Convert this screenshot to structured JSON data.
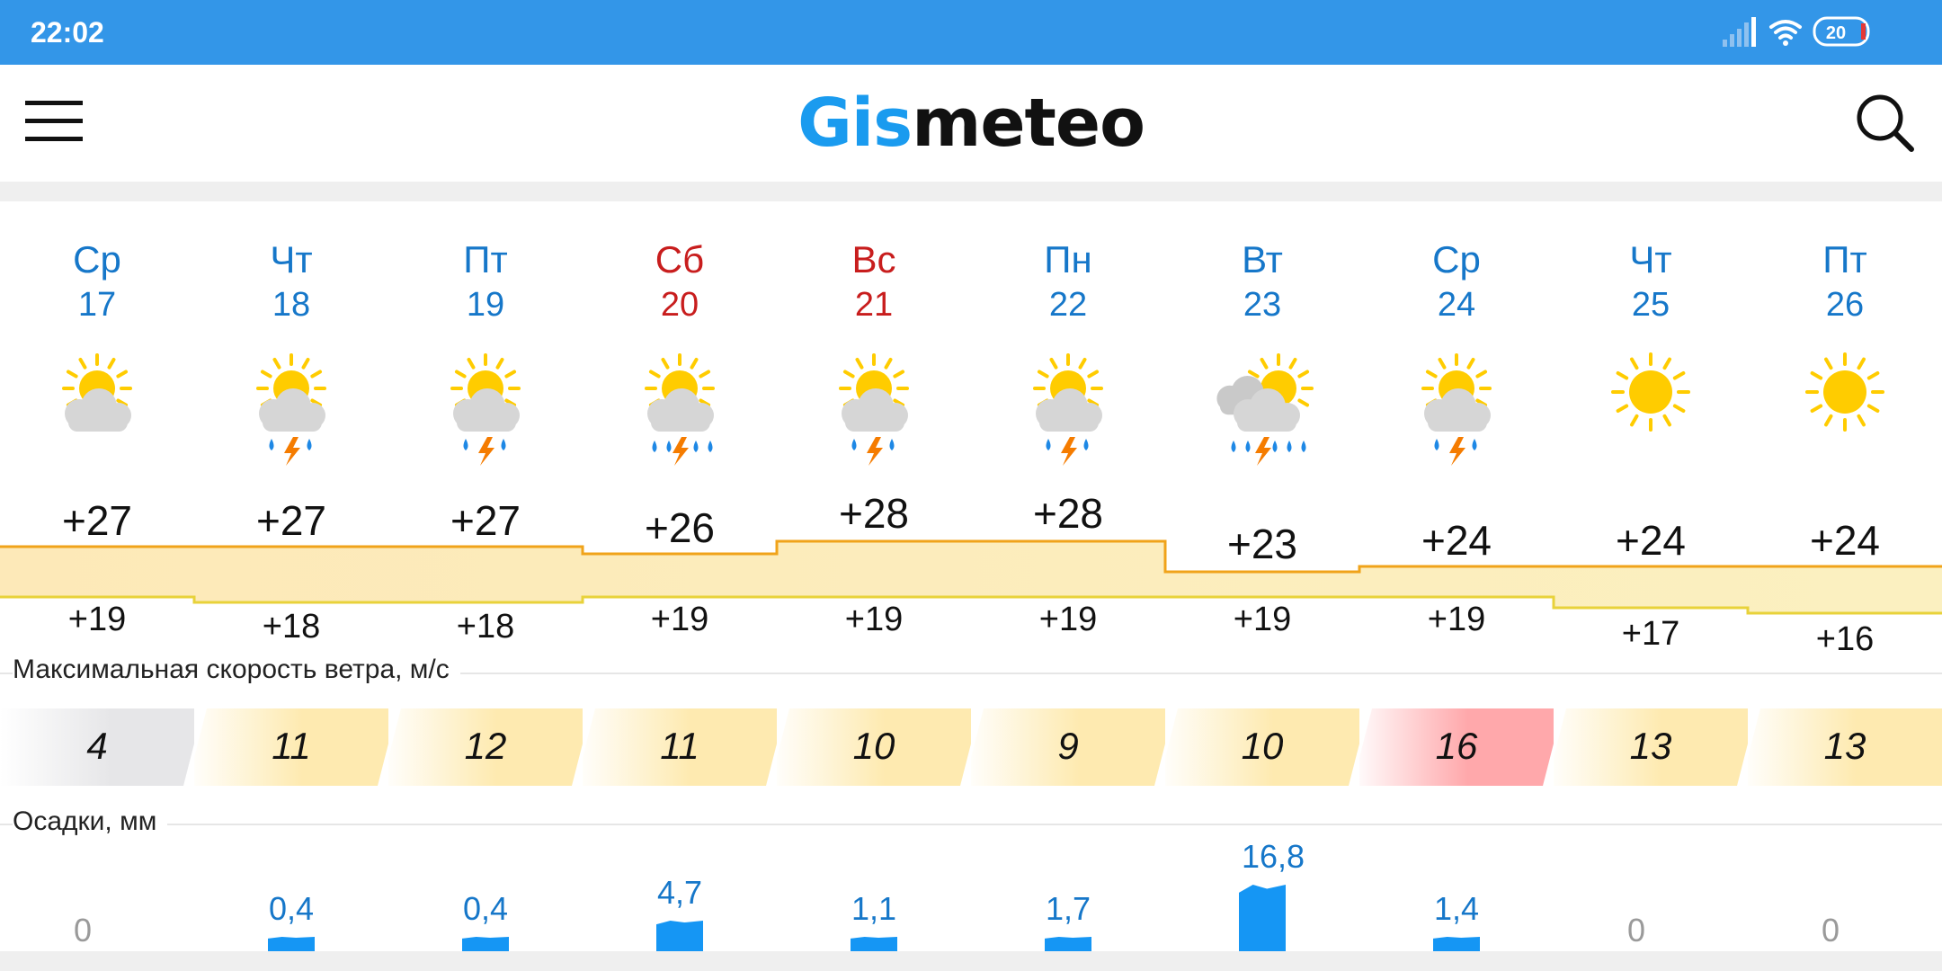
{
  "status": {
    "time": "22:02",
    "battery": "20"
  },
  "app": {
    "logo_part1": "Gis",
    "logo_part2": "meteo"
  },
  "colors": {
    "accent": "#3396e8",
    "logo_blue": "#1a9bef",
    "weekday": "#1677c9",
    "weekend": "#c81d1d",
    "precip": "#1596f4"
  },
  "days": [
    {
      "name": "Ср",
      "date": "17",
      "weekend": false,
      "icon": "sun-cloud-icon",
      "tmax": "+27",
      "tmin": "+19",
      "wind": "4",
      "precip": "0"
    },
    {
      "name": "Чт",
      "date": "18",
      "weekend": false,
      "icon": "sun-cloud-thunder-rain-icon",
      "tmax": "+27",
      "tmin": "+18",
      "wind": "11",
      "precip": "0,4"
    },
    {
      "name": "Пт",
      "date": "19",
      "weekend": false,
      "icon": "sun-cloud-thunder-rain-icon",
      "tmax": "+27",
      "tmin": "+18",
      "wind": "12",
      "precip": "0,4"
    },
    {
      "name": "Сб",
      "date": "20",
      "weekend": true,
      "icon": "sun-cloud-thunder-heavy-rain-icon",
      "tmax": "+26",
      "tmin": "+19",
      "wind": "11",
      "precip": "4,7"
    },
    {
      "name": "Вс",
      "date": "21",
      "weekend": true,
      "icon": "sun-cloud-thunder-rain-icon",
      "tmax": "+28",
      "tmin": "+19",
      "wind": "10",
      "precip": "1,1"
    },
    {
      "name": "Пн",
      "date": "22",
      "weekend": false,
      "icon": "sun-cloud-thunder-rain-icon",
      "tmax": "+28",
      "tmin": "+19",
      "wind": "9",
      "precip": "1,7"
    },
    {
      "name": "Вт",
      "date": "23",
      "weekend": false,
      "icon": "cloudy-thunder-heavy-rain-icon",
      "tmax": "+23",
      "tmin": "+19",
      "wind": "10",
      "precip": "16,8"
    },
    {
      "name": "Ср",
      "date": "24",
      "weekend": false,
      "icon": "sun-cloud-thunder-rain-icon",
      "tmax": "+24",
      "tmin": "+19",
      "wind": "16",
      "precip": "1,4"
    },
    {
      "name": "Чт",
      "date": "25",
      "weekend": false,
      "icon": "sun-icon",
      "tmax": "+24",
      "tmin": "+17",
      "wind": "13",
      "precip": "0"
    },
    {
      "name": "Пт",
      "date": "26",
      "weekend": false,
      "icon": "sun-icon",
      "tmax": "+24",
      "tmin": "+16",
      "wind": "13",
      "precip": "0"
    }
  ],
  "sections": {
    "wind_label": "Максимальная скорость ветра, м/с",
    "precip_label": "Осадки, мм"
  }
}
